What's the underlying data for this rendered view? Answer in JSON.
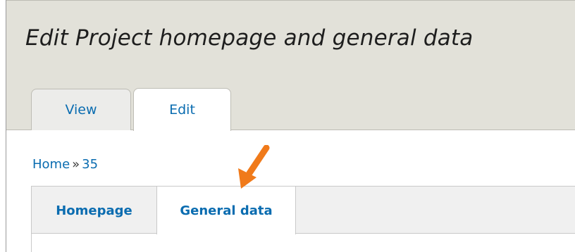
{
  "page": {
    "title": "Edit Project homepage and general data"
  },
  "primary_tabs": [
    {
      "label": "View",
      "active": false
    },
    {
      "label": "Edit",
      "active": true
    }
  ],
  "breadcrumb": {
    "items": [
      "Home",
      "35"
    ],
    "separator": "»"
  },
  "secondary_tabs": [
    {
      "label": "Homepage",
      "active": false
    },
    {
      "label": "General data",
      "active": true
    }
  ],
  "annotation": {
    "icon": "arrow-pointer-icon",
    "color": "#f07a1a"
  },
  "colors": {
    "link": "#0a6cb0",
    "header_bg": "#e2e1d9",
    "tab_bar_bg": "#f0f0f0"
  }
}
